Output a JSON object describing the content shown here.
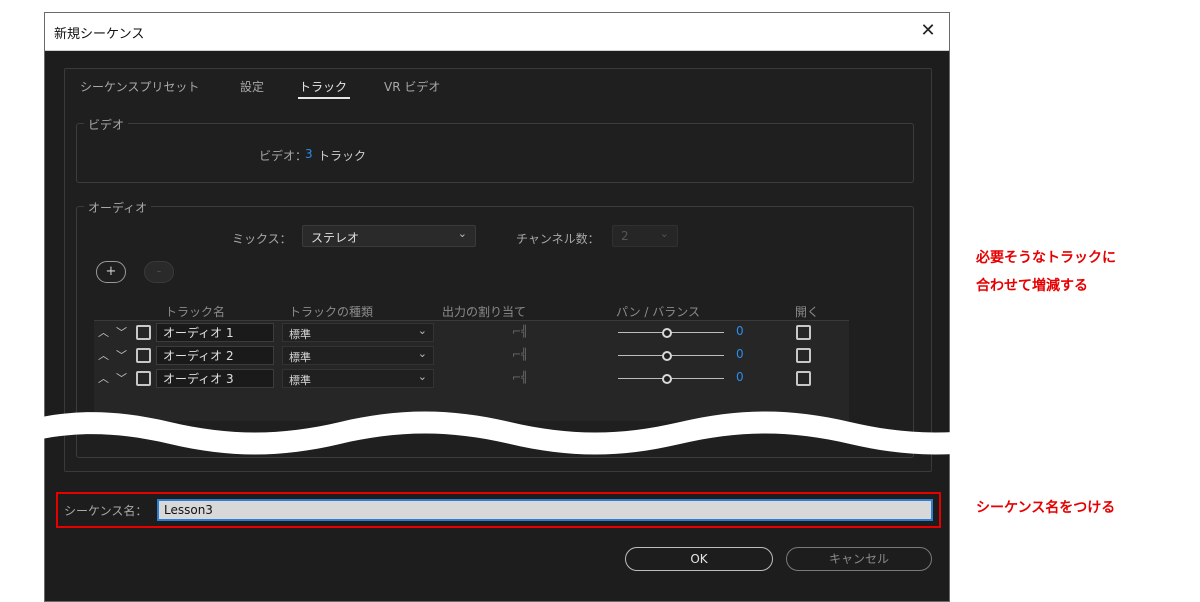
{
  "window": {
    "title": "新規シーケンス",
    "close_glyph": "✕"
  },
  "tabs": [
    {
      "label": "シーケンスプリセット",
      "active": false
    },
    {
      "label": "設定",
      "active": false
    },
    {
      "label": "トラック",
      "active": true
    },
    {
      "label": "VR ビデオ",
      "active": false
    }
  ],
  "video": {
    "legend": "ビデオ",
    "label": "ビデオ：",
    "count": "3",
    "unit": "トラック"
  },
  "audio": {
    "legend": "オーディオ",
    "mix_label": "ミックス：",
    "mix_value": "ステレオ",
    "channels_label": "チャンネル数：",
    "channels_value": "2",
    "add_button": "+",
    "remove_button": "-",
    "columns": [
      "トラック名",
      "トラックの種類",
      "出力の割り当て",
      "パン / バランス",
      "開く"
    ],
    "tracks": [
      {
        "name": "オーディオ 1",
        "type": "標準",
        "pan": "0"
      },
      {
        "name": "オーディオ 2",
        "type": "標準",
        "pan": "0"
      },
      {
        "name": "オーディオ 3",
        "type": "標準",
        "pan": "0"
      }
    ]
  },
  "sequence_name": {
    "label": "シーケンス名：",
    "value": "Lesson3"
  },
  "buttons": {
    "ok": "OK",
    "cancel": "キャンセル"
  },
  "annotations": {
    "tracks_note_line1": "必要そうなトラックに",
    "tracks_note_line2": "合わせて増減する",
    "name_note": "シーケンス名をつける"
  },
  "colors": {
    "accent_blue": "#2d8ceb",
    "annotation_red": "#e60000",
    "dialog_bg": "#1d1d1d"
  }
}
